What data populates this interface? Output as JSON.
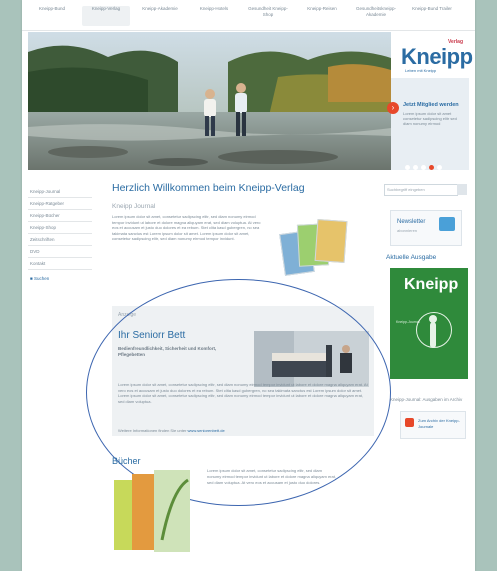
{
  "nav": {
    "items": [
      {
        "label": "Kneipp-Bund"
      },
      {
        "label": "Kneipp-Verlag"
      },
      {
        "label": "Kneipp-Akademie"
      },
      {
        "label": "Kneipp-Hotels"
      },
      {
        "label": "Gesundheit Kneipp-Shop"
      },
      {
        "label": "Kneipp-Reisen"
      },
      {
        "label": "Gesundheitskneipp-Akademie"
      },
      {
        "label": "Kneipp-Bund Trailer"
      }
    ],
    "active_index": 1
  },
  "promo": {
    "logo_verlag": "Verlag",
    "logo": "Kneipp",
    "logo_sub": "Leben mit Kneipp",
    "arrow": "›",
    "title": "Jetzt Mitglied werden",
    "text": "Lorem ipsum dolor sit amet consetetur sadipscing elitr sed diam nonumy eirmod"
  },
  "left_nav": {
    "items": [
      "Kneipp-Journal",
      "Kneipp-Ratgeber",
      "Kneipp-Bücher",
      "Kneipp-Shop",
      "Zeitschriften",
      "DVD",
      "Kontakt"
    ],
    "search_label": "Suchen"
  },
  "main": {
    "title": "Herzlich Willkommen beim Kneipp-Verlag",
    "subtitle": "Kneipp Journal",
    "intro": "Lorem ipsum dolor sit amet, consetetur sadipscing elitr, sed diam nonumy eirmod tempor invidunt ut labore et dolore magna aliquyam erat, sed diam voluptua. At vero eos et accusam et justo duo dolores et ea rebum. Stet clita kasd gubergren, no sea takimata sanctus est Lorem ipsum dolor sit amet. Lorem ipsum dolor sit amet, consetetur sadipscing elitr, sed diam nonumy eirmod tempor invidunt."
  },
  "ad": {
    "label": "Anzeige",
    "title": "Ihr Seniorr Bett",
    "features": "Bedienfreundlichkeit, Sicherheit und Komfort, Pflegebetten",
    "body": "Lorem ipsum dolor sit amet, consetetur sadipscing elitr, sed diam nonumy eirmod tempor invidunt ut labore et dolore magna aliquyam erat. At vero eos et accusam et justo duo dolores et ea rebum. Stet clita kasd gubergren, no sea takimata sanctus est Lorem ipsum dolor sit amet. Lorem ipsum dolor sit amet, consetetur sadipscing elitr, sed diam nonumy eirmod tempor invidunt ut labore et dolore magna aliquyam erat, sed diam voluptua.",
    "link_prefix": "Weitere Informationen finden Sie unter",
    "link_text": "www.seniorenbett.de"
  },
  "books": {
    "title": "Bücher",
    "text": "Lorem ipsum dolor sit amet, consetetur sadipscing elitr, sed diam nonumy eirmod tempor invidunt ut labore et dolore magna aliquyam erat, sed diam voluptua. At vero eos et accusam et justo duo dolores."
  },
  "right": {
    "search_placeholder": "Suchbegriff eingeben",
    "newsletter_title": "Newsletter",
    "newsletter_sub": "abonnieren",
    "current_title": "Aktuelle Ausgabe",
    "cover_logo": "Kneipp",
    "cover_sub": "Kneipp-Journal",
    "note": "Kneipp-Journal: Ausgaben im Archiv",
    "button_text": "Zum Archiv der Kneipp-Journale"
  }
}
